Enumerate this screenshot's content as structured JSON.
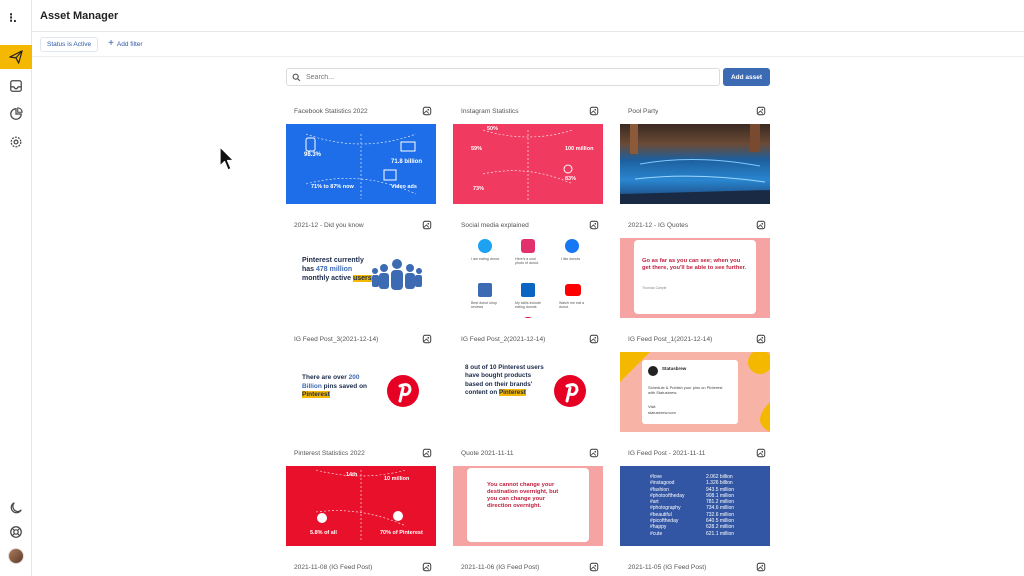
{
  "app": {
    "title": "Asset Manager"
  },
  "sidebar": {
    "logo": "⁝.",
    "items": [
      {
        "name": "send-icon",
        "active": true
      },
      {
        "name": "inbox-icon",
        "active": false
      },
      {
        "name": "analytics-icon",
        "active": false
      },
      {
        "name": "settings-icon",
        "active": false
      }
    ],
    "bottom": [
      "moon-icon",
      "help-icon",
      "avatar"
    ]
  },
  "filters": {
    "chip": "Status is Active",
    "add_filter": "Add filter"
  },
  "search": {
    "placeholder": "Search..."
  },
  "add_asset_label": "Add asset",
  "cards": [
    {
      "title": "Facebook Statistics 2022",
      "thumb": {
        "bg": "#1d6ee8",
        "lines": [
          "98.3%",
          "71.8 billion",
          "71% to 87% now",
          "Video ads"
        ]
      }
    },
    {
      "title": "Instagram Statistics",
      "thumb": {
        "bg": "#f03a5f",
        "lines": [
          "50%",
          "59%",
          "100 million",
          "83%",
          "73%"
        ]
      }
    },
    {
      "title": "Pool Party",
      "thumb": {
        "bg": "#1f4f8a"
      }
    },
    {
      "title": "2021-12 - Did you know",
      "thumb": {
        "bg": "#ffffff",
        "lines": [
          "Pinterest currently has",
          "478 million",
          "monthly active",
          "users"
        ]
      }
    },
    {
      "title": "Social media explained",
      "thumb": {
        "bg": "#ffffff",
        "lines": [
          "I am eating donut.",
          "Here's a cool photo of donut.",
          "I like donuts",
          "Best donut shop reviews",
          "My skills include eating donuts",
          "Watch me eat a donut."
        ]
      }
    },
    {
      "title": "2021-12 - IG Quotes",
      "thumb": {
        "bg": "#f5a3a3",
        "lines": [
          "Go as far as you can see; when you get there, you'll be able to see further.",
          "Thomas Carlyle"
        ]
      }
    },
    {
      "title": "IG Feed Post_3(2021-12-14)",
      "thumb": {
        "bg": "#ffffff",
        "lines": [
          "There are over",
          "200 Billion",
          "pins saved on",
          "Pinterest"
        ]
      }
    },
    {
      "title": "IG Feed Post_2(2021-12-14)",
      "thumb": {
        "bg": "#ffffff",
        "lines": [
          "8 out of 10 Pinterest users have bought products based on their brands' content on",
          "Pinterest"
        ]
      }
    },
    {
      "title": "IG Feed Post_1(2021-12-14)",
      "thumb": {
        "bg": "#f7b4a6",
        "lines": [
          "Statusbrew",
          "Schedule & Publish your pins on Pinterest with Statusbrew.",
          "Visit",
          "statusbrew.com"
        ]
      }
    },
    {
      "title": "Pinterest Statistics 2022",
      "thumb": {
        "bg": "#e8102a",
        "lines": [
          "14th",
          "10 million",
          "5.8% of all",
          "70% of Pinterest"
        ]
      }
    },
    {
      "title": "Quote 2021-11-11",
      "thumb": {
        "bg": "#f5a3a3",
        "lines": [
          "You cannot change your destination overnight, but you can change your direction overnight."
        ]
      }
    },
    {
      "title": "IG Feed Post - 2021-11-11",
      "thumb": {
        "bg": "#3256a3",
        "tags": [
          "#love",
          "#instagood",
          "#fashion",
          "#photooftheday",
          "#art",
          "#photography",
          "#beautiful",
          "#picoftheday",
          "#happy",
          "#cute"
        ],
        "counts": [
          "2.062 billion",
          "1.326 billion",
          "943.5 million",
          "908.1 million",
          "781.2 million",
          "734.6 million",
          "732.6 million",
          "640.5 million",
          "628.2 million",
          "621.1 million"
        ]
      }
    },
    {
      "title": "2021-11-08 (IG Feed Post)",
      "thumb": {
        "bg": "#ffffff"
      }
    },
    {
      "title": "2021-11-06 (IG Feed Post)",
      "thumb": {
        "bg": "#ffffff"
      }
    },
    {
      "title": "2021-11-05 (IG Feed Post)",
      "thumb": {
        "bg": "#ffffff"
      }
    }
  ]
}
